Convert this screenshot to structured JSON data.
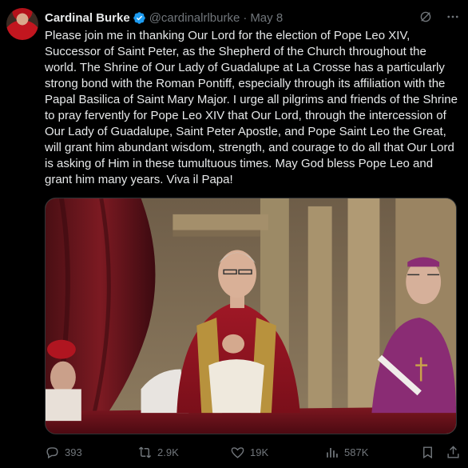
{
  "author": {
    "name": "Cardinal Burke",
    "handle": "@cardinalrlburke",
    "separator": "·",
    "date": "May 8"
  },
  "post": {
    "text": "Please join me in thanking Our Lord for the election of Pope Leo XIV, Successor of Saint Peter, as the Shepherd of the Church throughout the world. The Shrine of Our Lady of Guadalupe at La Crosse has a particularly strong bond with the Roman Pontiff, especially through its affiliation with the Papal Basilica of Saint Mary Major. I urge all pilgrims and friends of the Shrine to pray fervently for Pope Leo XIV that Our Lord, through the intercession of Our Lady of Guadalupe, Saint Peter Apostle, and Pope Saint Leo the Great, will grant him abundant wisdom, strength, and courage to do all that Our Lord is asking of Him in these tumultuous times. May God bless Pope Leo and grant him many years. Viva il Papa!"
  },
  "metrics": {
    "replies": "393",
    "reposts": "2.9K",
    "likes": "19K",
    "views": "587K"
  },
  "colors": {
    "background": "#000000",
    "text": "#e7e9ea",
    "muted": "#71767b",
    "verified": "#1d9bf0"
  },
  "icons": [
    "verified-badge-icon",
    "grok-icon",
    "more-icon",
    "reply-icon",
    "repost-icon",
    "like-icon",
    "views-icon",
    "bookmark-icon",
    "share-icon"
  ]
}
